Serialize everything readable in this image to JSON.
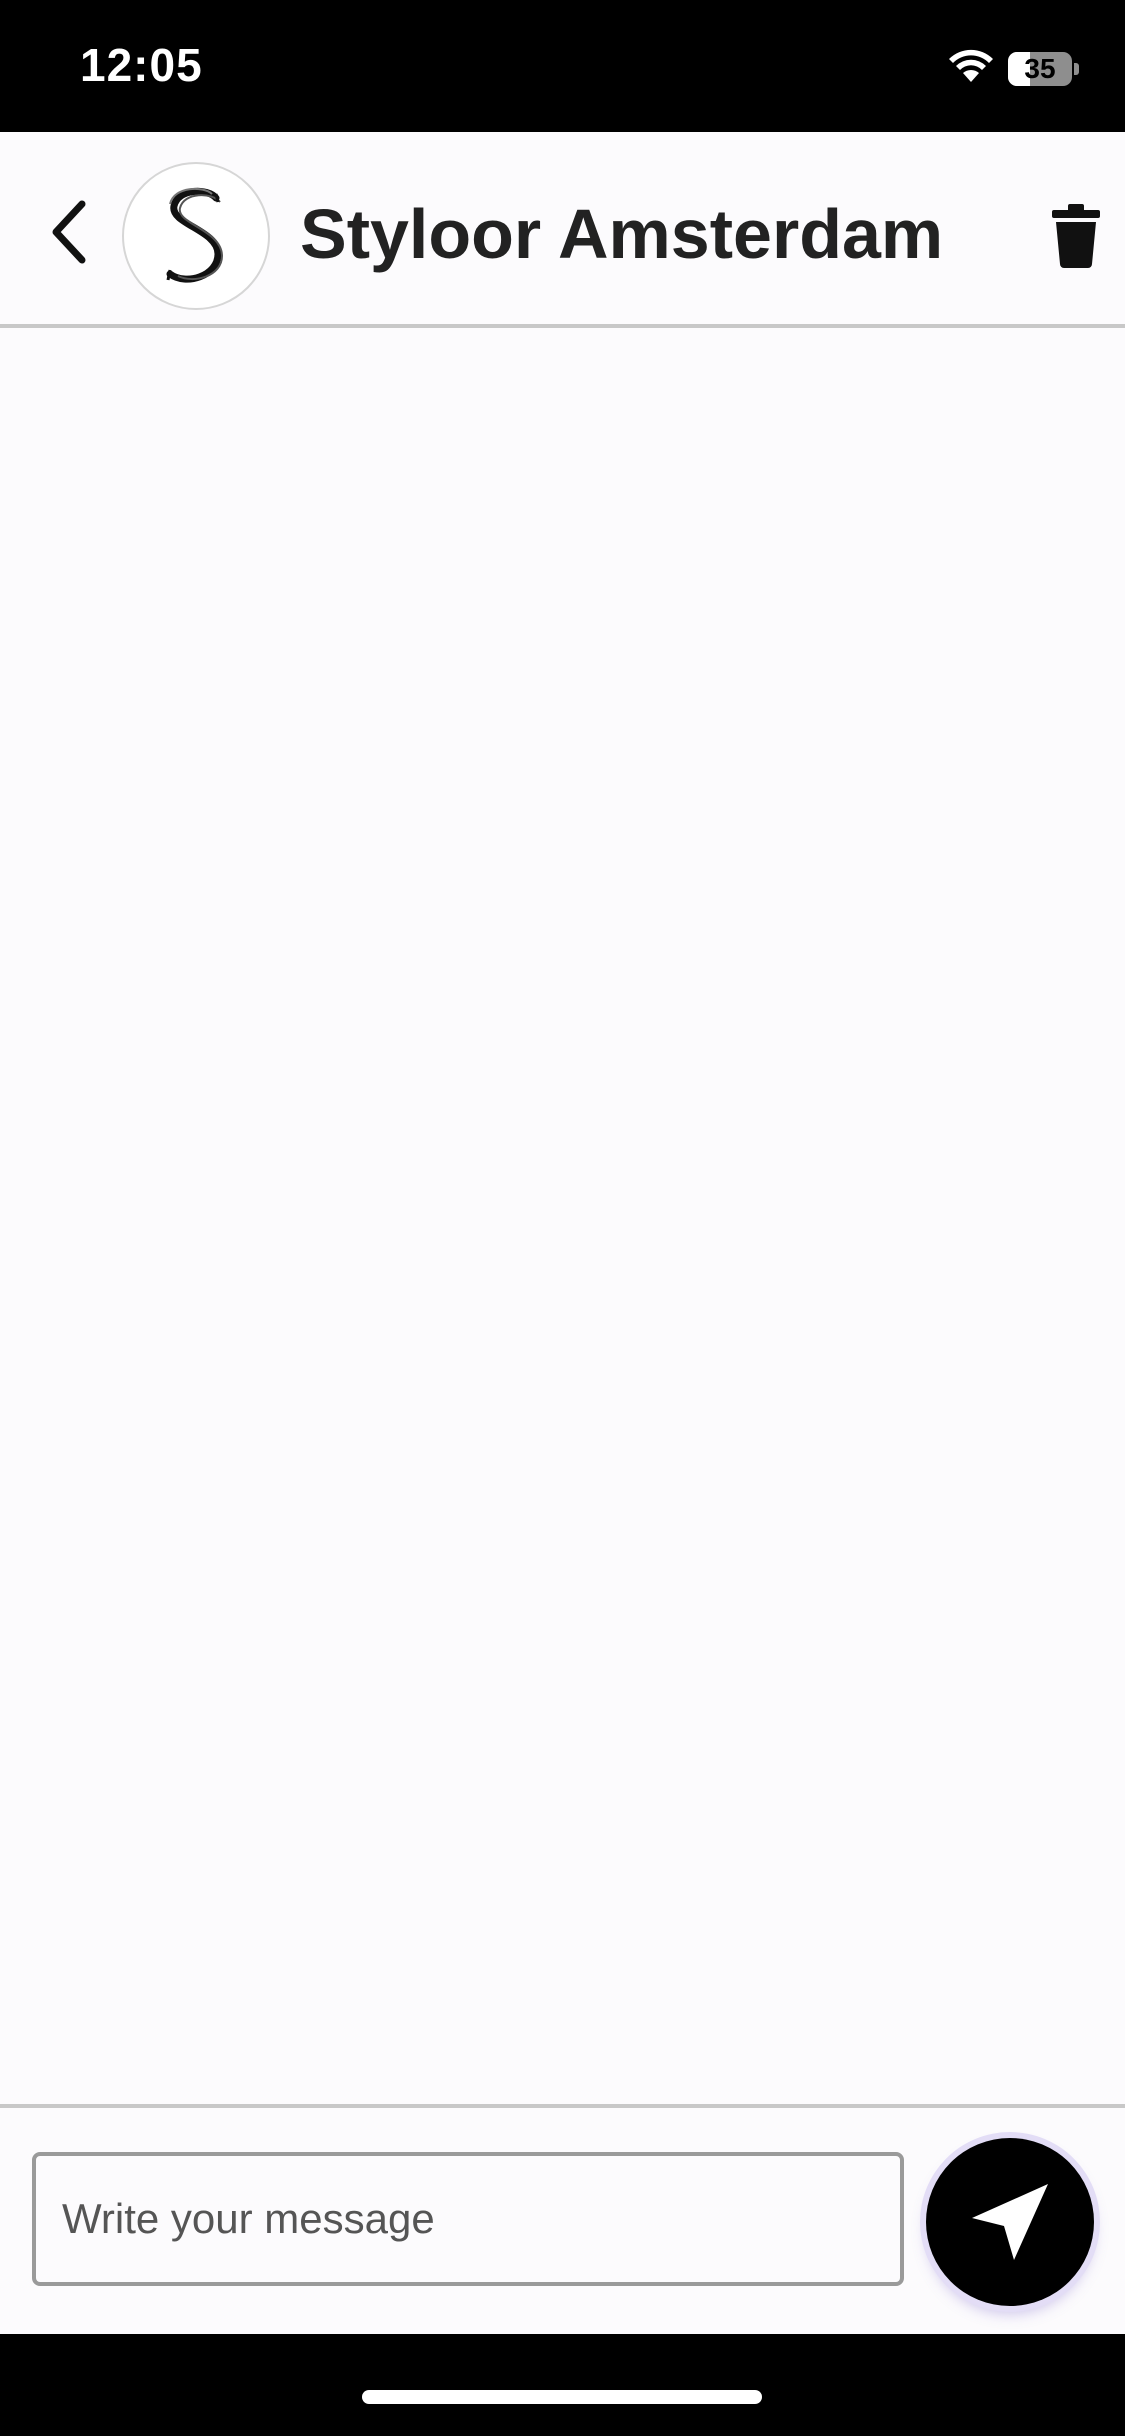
{
  "status_bar": {
    "time": "12:05",
    "battery_level": "35",
    "battery_fraction": 0.35
  },
  "header": {
    "title": "Styloor Amsterdam",
    "avatar_icon": "styloor-s-logo",
    "back_icon": "chevron-left-icon",
    "delete_icon": "trash-icon"
  },
  "chat": {
    "messages": []
  },
  "composer": {
    "input_value": "",
    "input_placeholder": "Write your message",
    "send_icon": "send-icon",
    "send_glow_color": "#e3ddf6"
  },
  "colors": {
    "background": "#fcfbfd",
    "status_bar": "#000000",
    "title_text": "#222222",
    "divider": "#c8c8c8",
    "send_button": "#000000"
  }
}
